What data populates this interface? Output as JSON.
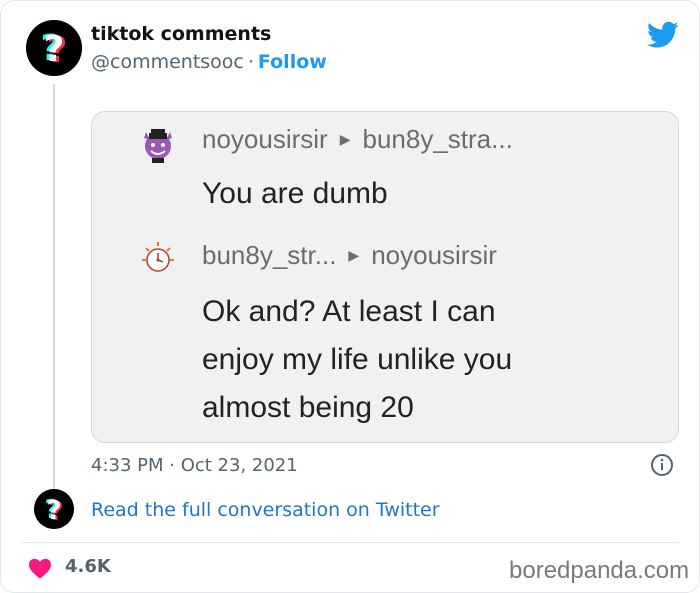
{
  "tweet": {
    "author_name": "tiktok comments",
    "author_handle": "@commentsooc",
    "separator": "·",
    "follow_label": "Follow",
    "timestamp": "4:33 PM · Oct 23, 2021",
    "read_full_label": "Read the full conversation on Twitter",
    "likes_count": "4.6K"
  },
  "screenshot": {
    "comment1": {
      "from": "noyousirsir",
      "to": "bun8y_stra...",
      "text": "You are dumb"
    },
    "comment2": {
      "from": "bun8y_str...",
      "to": "noyousirsir",
      "text_line1": "Ok and? At least I can",
      "text_line2": "enjoy my life unlike you",
      "text_line3": "almost being 20"
    }
  },
  "watermark": "boredpanda.com",
  "colors": {
    "link_blue": "#1d9bf0",
    "heart_pink": "#f91880",
    "tiktok_cyan": "#25f4ee",
    "tiktok_red": "#fe2c55"
  },
  "icons": [
    "question-mark-avatar-icon",
    "twitter-bird-icon",
    "info-icon",
    "heart-icon",
    "devil-emoji-icon",
    "clock-avatar-icon"
  ]
}
